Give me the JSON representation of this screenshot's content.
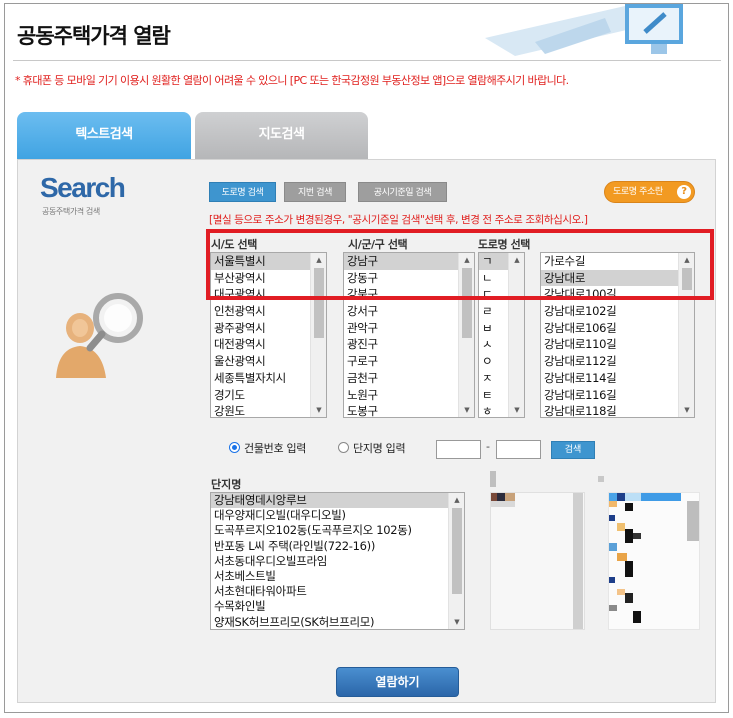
{
  "page": {
    "title": "공동주택가격 열람",
    "notice": "* 휴대폰 등 모바일 기기 이용시 원활한 열람이 어려울 수 있으니 [PC 또는 한국감정원 부동산정보 앱]으로 열람해주시기 바랍니다."
  },
  "tabs": [
    {
      "label": "텍스트검색",
      "active": true
    },
    {
      "label": "지도검색",
      "active": false
    }
  ],
  "search": {
    "logo": "Search",
    "logo_sub": "공동주택가격 검색",
    "mode_buttons": [
      "도로명 검색",
      "지번 검색",
      "공시기준일 검색"
    ],
    "address_book_button": "도로명 주소란",
    "hint": "[멸실 등으로 주소가 변경된경우, \"공시기준일 검색\"선택 후, 변경 전 주소로 조회하십시오.]"
  },
  "columns": {
    "sido_label": "시/도 선택",
    "sigungu_label": "시/군/구 선택",
    "road_label": "도로명 선택"
  },
  "sido_options": [
    "서울특별시",
    "부산광역시",
    "대구광역시",
    "인천광역시",
    "광주광역시",
    "대전광역시",
    "울산광역시",
    "세종특별자치시",
    "경기도",
    "강원도"
  ],
  "sigungu_options": [
    "강남구",
    "강동구",
    "강북구",
    "강서구",
    "관악구",
    "광진구",
    "구로구",
    "금천구",
    "노원구",
    "도봉구"
  ],
  "consonant_options": [
    "ㄱ",
    "ㄴ",
    "ㄷ",
    "ㄹ",
    "ㅂ",
    "ㅅ",
    "ㅇ",
    "ㅈ",
    "ㅌ",
    "ㅎ"
  ],
  "road_options": [
    "가로수길",
    "강남대로",
    "강남대로100길",
    "강남대로102길",
    "강남대로106길",
    "강남대로110길",
    "강남대로112길",
    "강남대로114길",
    "강남대로116길",
    "강남대로118길"
  ],
  "selected": {
    "sido": "서울특별시",
    "sigungu": "강남구",
    "consonant": "ㄱ",
    "road": "강남대로"
  },
  "input_mode": {
    "building_number_label": "건물번호 입력",
    "complex_name_label": "단지명 입력",
    "selected": "건물번호 입력",
    "search_button": "검색",
    "dash": "-"
  },
  "complex": {
    "label": "단지명",
    "options": [
      "강남태영데시앙루브",
      "대우양재디오빌(대우디오빌)",
      "도곡푸르지오102동(도곡푸르지오 102동)",
      "반포동 L씨 주택(라인빌(722-16))",
      "서초동대우디오빌프라임",
      "서초베스트빌",
      "서초현대타워아파트",
      "수목화인빌",
      "양재SK허브프리모(SK허브프리모)"
    ],
    "selected": "강남태영데시앙루브"
  },
  "view_button": "열람하기",
  "colors": {
    "accent_blue": "#3e95cf",
    "highlight_red": "#e11d24",
    "notice_red": "#e0201e",
    "addr_orange": "#f29a22"
  }
}
